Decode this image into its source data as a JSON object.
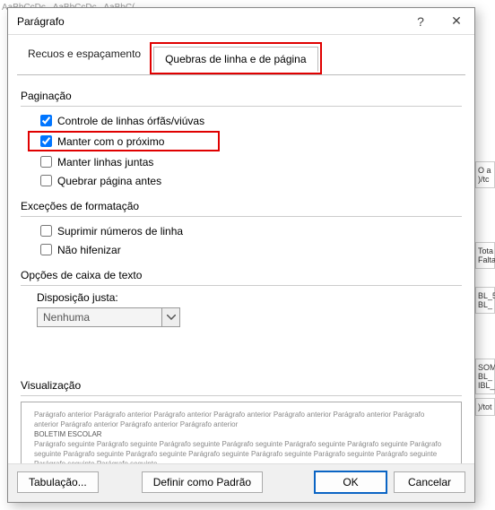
{
  "bg": {
    "styles_line": "AaBbCcDc   AaBbCcDc   AaBbC(",
    "r1": "O a\n)/tc",
    "r2": "Tota\nFalta",
    "r3": "BL_5\nBL_",
    "r4": "SOM\nBL_\nIBL_",
    "r5": ")/tot"
  },
  "dialog": {
    "title": "Parágrafo",
    "help": "?",
    "close": "✕"
  },
  "tabs": {
    "indent": "Recuos e espaçamento",
    "breaks": "Quebras de linha e de página"
  },
  "pagination": {
    "label": "Paginação",
    "widow": "Controle de linhas órfãs/viúvas",
    "keepnext": "Manter com o próximo",
    "keeplines": "Manter linhas juntas",
    "breakbefore": "Quebrar página antes"
  },
  "exceptions": {
    "label": "Exceções de formatação",
    "suppress": "Suprimir números de linha",
    "nohyphen": "Não hifenizar"
  },
  "textbox": {
    "label": "Opções de caixa de texto",
    "tightwrap": "Disposição justa:",
    "value": "Nenhuma"
  },
  "preview": {
    "label": "Visualização",
    "before": "Parágrafo anterior Parágrafo anterior Parágrafo anterior Parágrafo anterior Parágrafo anterior Parágrafo anterior Parágrafo anterior Parágrafo anterior Parágrafo anterior Parágrafo anterior",
    "sample": "BOLETIM ESCOLAR",
    "after": "Parágrafo seguinte Parágrafo seguinte Parágrafo seguinte Parágrafo seguinte Parágrafo seguinte Parágrafo seguinte Parágrafo seguinte Parágrafo seguinte Parágrafo seguinte Parágrafo seguinte Parágrafo seguinte Parágrafo seguinte Parágrafo seguinte Parágrafo seguinte Parágrafo seguinte"
  },
  "buttons": {
    "tabs": "Tabulação...",
    "default": "Definir como Padrão",
    "ok": "OK",
    "cancel": "Cancelar"
  }
}
